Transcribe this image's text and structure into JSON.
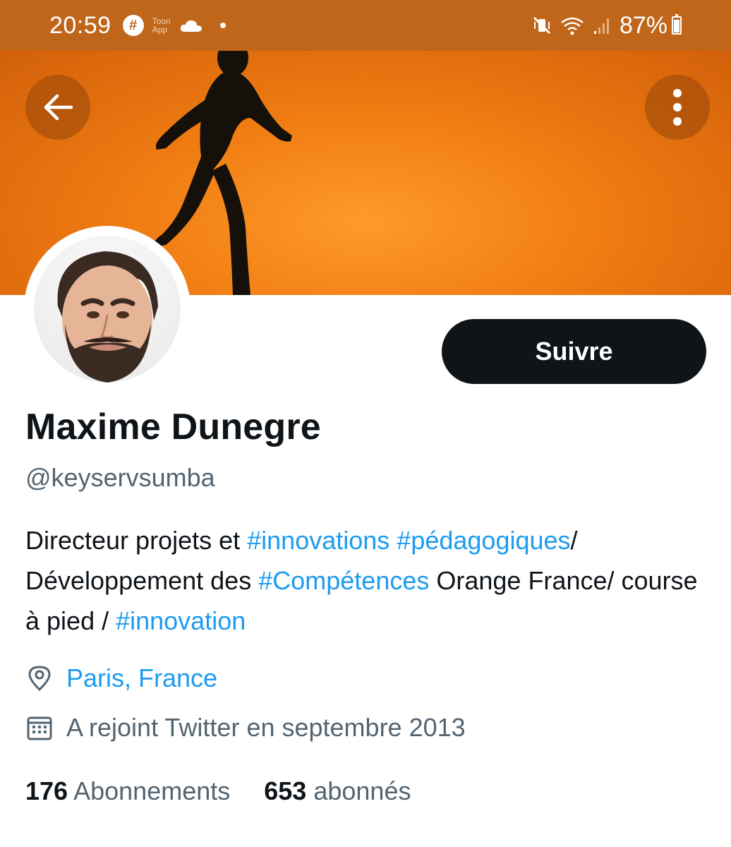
{
  "status_bar": {
    "time": "20:59",
    "hash_badge": "#",
    "toon_app": [
      "Toon",
      "App"
    ],
    "battery": "87%"
  },
  "header": {
    "back_icon": "arrow-left-icon",
    "more_icon": "more-vertical-icon"
  },
  "profile": {
    "follow_label": "Suivre",
    "name": "Maxime Dunegre",
    "handle": "@keyservsumba",
    "bio": {
      "part1": "Directeur projets et ",
      "tag1": "#innovations",
      "sep1": " ",
      "tag2": "#pédagogiques",
      "part2": "/ Développement des ",
      "tag3": "#Compétences",
      "part3": " Orange France/ course à pied / ",
      "tag4": "#innovation"
    },
    "location": "Paris, France",
    "joined": "A rejoint Twitter en septembre 2013",
    "following_count": "176",
    "following_label": "Abonnements",
    "followers_count": "653",
    "followers_label": "abonnés"
  },
  "colors": {
    "accent": "#1d9bf0",
    "status_bar": "#c0661a",
    "button_bg": "#0f1419",
    "secondary_text": "#536471"
  }
}
